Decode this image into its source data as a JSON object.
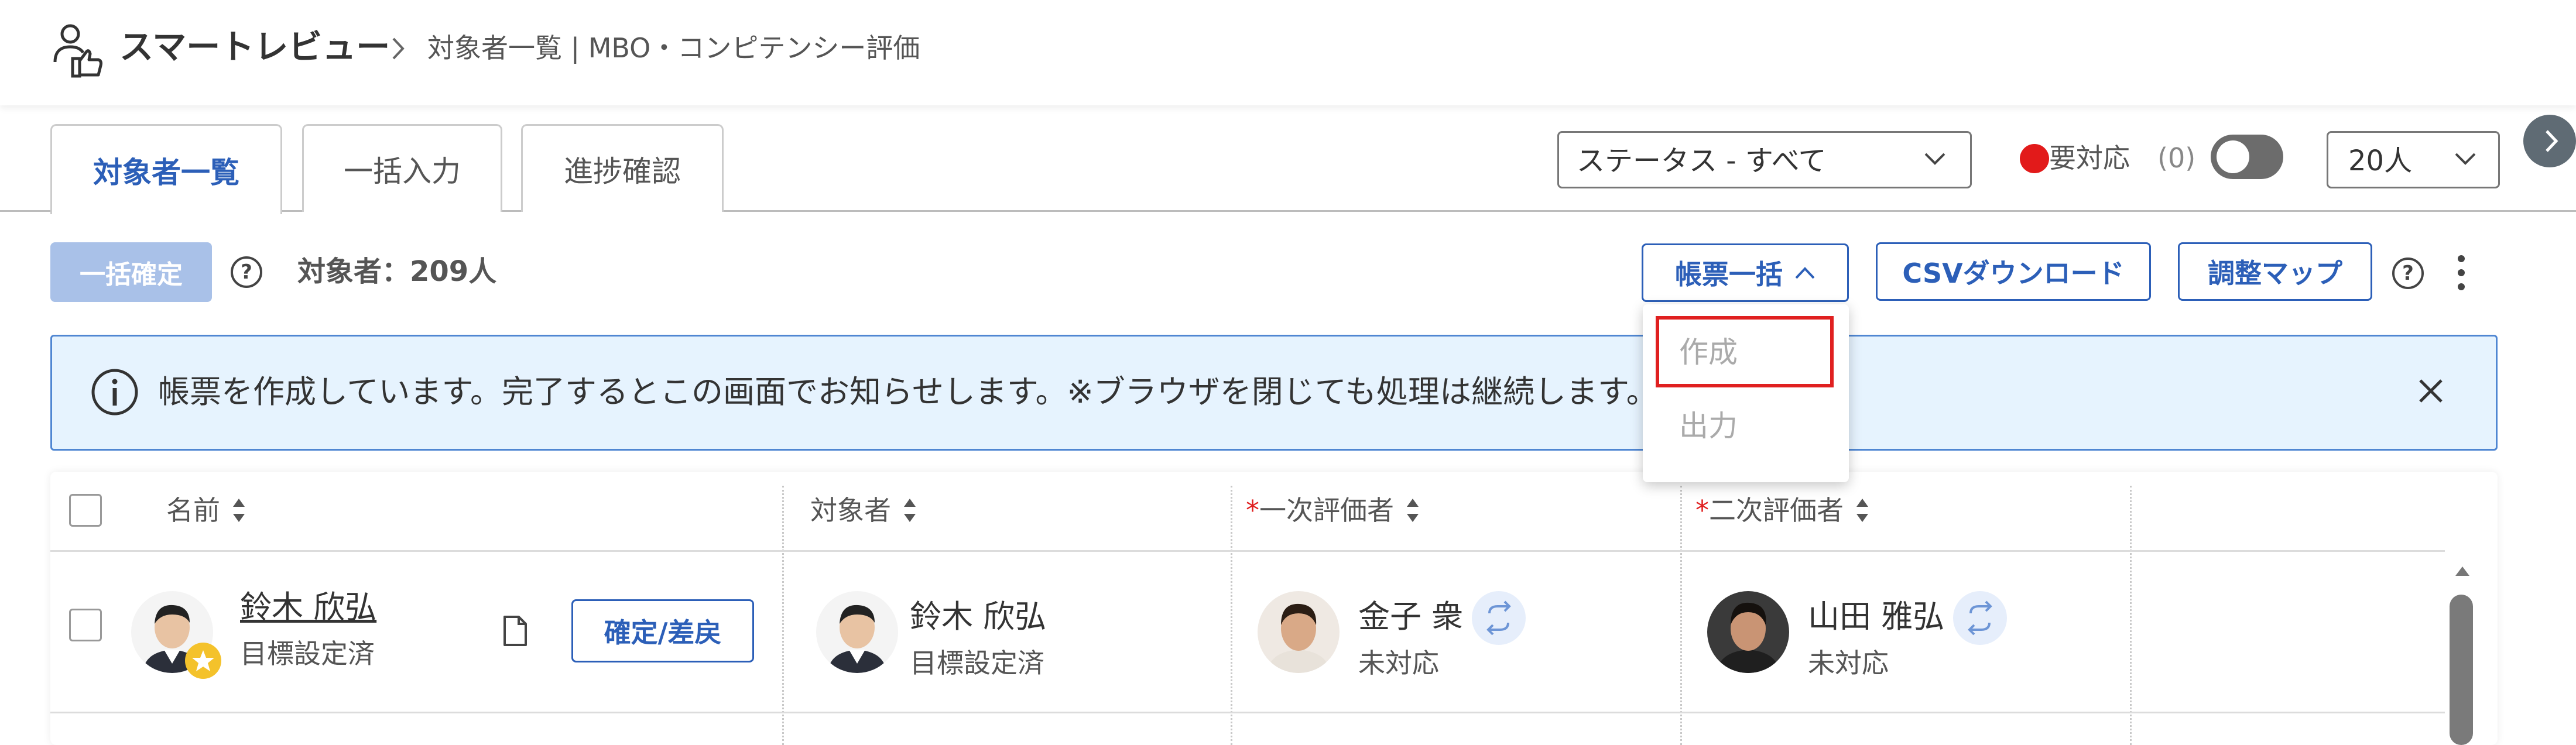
{
  "header": {
    "app_name": "スマートレビュー",
    "breadcrumb": "対象者一覧 | MBO・コンピテンシー評価"
  },
  "tabs": [
    {
      "label": "対象者一覧",
      "active": true
    },
    {
      "label": "一括入力",
      "active": false
    },
    {
      "label": "進捗確認",
      "active": false
    }
  ],
  "filters": {
    "status_select": "ステータス - すべて",
    "requires_action_label": "要対応",
    "requires_action_count": "(0)",
    "requires_action_toggle": "off",
    "per_page": "20人"
  },
  "toolbar": {
    "bulk_confirm": "一括確定",
    "target_count": "対象者：209人",
    "forms_bulk": "帳票一括",
    "csv_download": "CSVダウンロード",
    "adjust_map": "調整マップ",
    "help_glyph": "?"
  },
  "forms_menu": {
    "items": [
      "作成",
      "出力"
    ]
  },
  "banner": {
    "text": "帳票を作成しています。完了するとこの画面でお知らせします。※ブラウザを閉じても処理は継続します。"
  },
  "table": {
    "columns": [
      {
        "label": "名前",
        "required": false
      },
      {
        "label": "対象者",
        "required": false
      },
      {
        "label": "一次評価者",
        "required": true
      },
      {
        "label": "二次評価者",
        "required": true
      }
    ],
    "required_mark": "*",
    "rows": [
      {
        "name": "鈴木 欣弘",
        "name_status": "目標設定済",
        "action": "確定/差戻",
        "target_name": "鈴木 欣弘",
        "target_status": "目標設定済",
        "first_evaluator": "金子 衆",
        "first_status": "未対応",
        "second_evaluator": "山田 雅弘",
        "second_status": "未対応"
      }
    ]
  },
  "colors": {
    "accent": "#2c5fb8",
    "banner_bg": "#e6f3fe",
    "alert_red": "#e21a1a"
  }
}
